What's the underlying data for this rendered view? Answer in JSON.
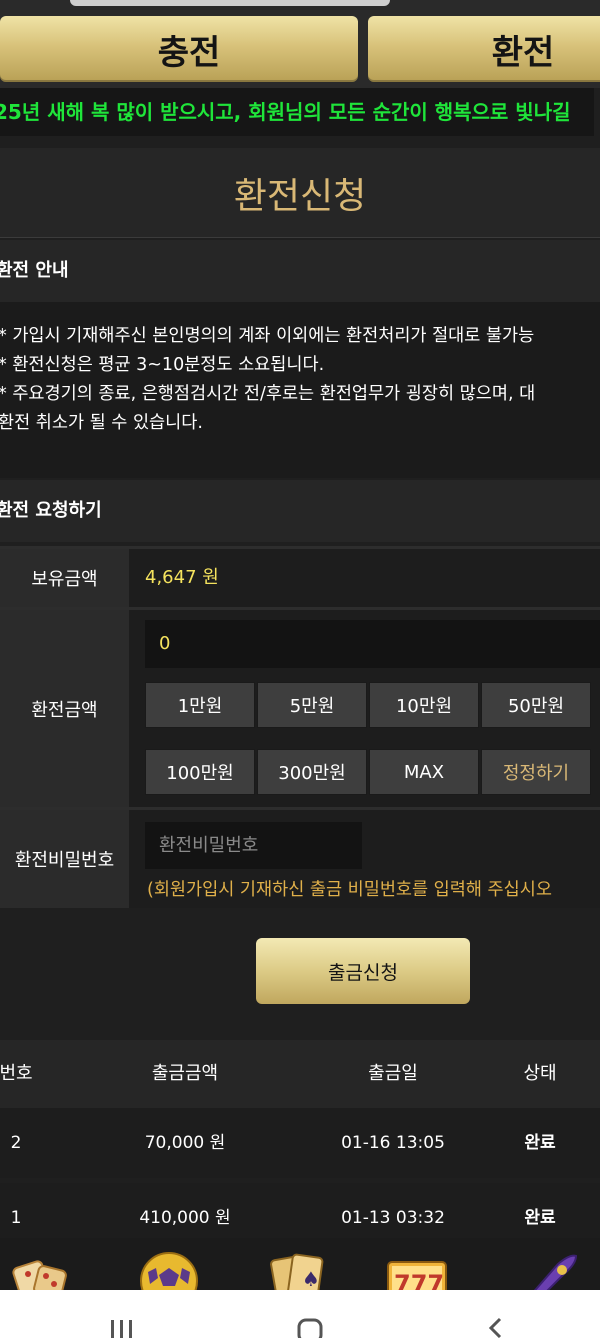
{
  "tabs": {
    "charge": "충전",
    "exchange": "환전"
  },
  "marquee": "25년 새해 복 많이 받으시고, 회원님의 모든 순간이 행복으로 빛나길",
  "page_title": "환전신청",
  "guide": {
    "title": "환전 안내",
    "lines": [
      "* 가입시 기재해주신 본인명의의 계좌 이외에는 환전처리가 절대로 불가능",
      "* 환전신청은 평균 3~10분정도 소요됩니다.",
      "* 주요경기의 종료, 은행점검시간 전/후로는 환전업무가 굉장히 많으며, 대",
      "환전 취소가 될 수 있습니다."
    ]
  },
  "request": {
    "title": "환전 요청하기",
    "balance_label": "보유금액",
    "balance_value": "4,647 원",
    "amount_label": "환전금액",
    "amount_value": "0",
    "amount_buttons": [
      "1만원",
      "5만원",
      "10만원",
      "50만원",
      "100만원",
      "300만원",
      "MAX",
      "정정하기"
    ],
    "password_label": "환전비밀번호",
    "password_placeholder": "환전비밀번호",
    "password_hint": "(회원가입시 기재하신 출금 비밀번호를 입력해 주십시오"
  },
  "submit_label": "출금신청",
  "history": {
    "headers": [
      "번호",
      "출금금액",
      "출금일",
      "상태"
    ],
    "rows": [
      {
        "no": "2",
        "amount": "70,000 원",
        "date": "01-16 13:05",
        "status": "완료"
      },
      {
        "no": "1",
        "amount": "410,000 원",
        "date": "01-13 03:32",
        "status": "완료"
      }
    ]
  },
  "game_icons": [
    "dice-icon",
    "soccer-ball-icon",
    "cards-icon",
    "slot-777-icon",
    "rocket-icon"
  ],
  "colors": {
    "gold": "#d9b876",
    "yellow_value": "#f5e35e",
    "marquee_green": "#1fe53a",
    "hint_orange": "#e0b04a"
  }
}
